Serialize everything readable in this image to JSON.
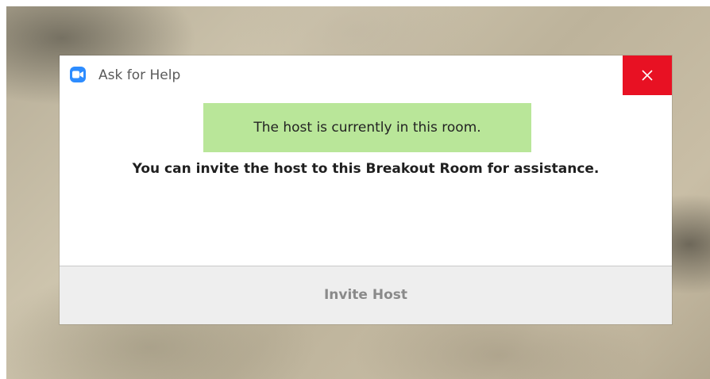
{
  "dialog": {
    "title": "Ask for Help",
    "close_icon": "close-icon",
    "app_icon": "zoom-camera-icon",
    "status_text": "The host is currently in this room.",
    "message": "You can invite the host to this Breakout Room for assistance.",
    "invite_button_label": "Invite Host",
    "invite_button_enabled": false
  },
  "colors": {
    "close_background": "#e81123",
    "status_background": "#b9e699",
    "app_icon_blue": "#2d8cff",
    "disabled_text": "#8a8a8a"
  }
}
